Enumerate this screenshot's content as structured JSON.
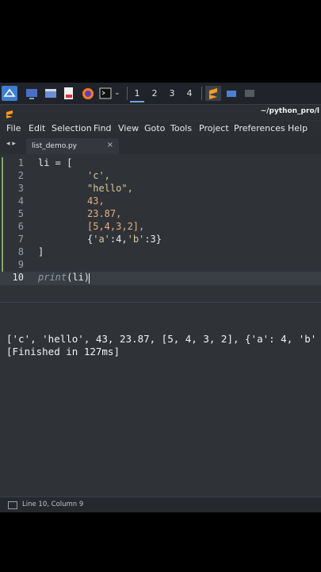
{
  "taskbar": {
    "workspaces": [
      "1",
      "2",
      "3",
      "4"
    ],
    "active_workspace": "1",
    "icons": [
      "start-menu-icon",
      "desktop-icon",
      "files-icon",
      "pdf-icon",
      "firefox-icon",
      "terminal-icon",
      "sublime-icon",
      "folder-icon",
      "window-icon"
    ],
    "accent": "#6da4e0"
  },
  "window": {
    "title_path": "~/python_pro/l"
  },
  "menu": {
    "items": [
      "File",
      "Edit",
      "Selection",
      "Find",
      "View",
      "Goto",
      "Tools",
      "Project",
      "Preferences",
      "Help"
    ]
  },
  "tabs": {
    "nav": "◂ ▸",
    "active_tab": "list_demo.py",
    "close": "×"
  },
  "editor": {
    "line_numbers": [
      "1",
      "2",
      "3",
      "4",
      "5",
      "6",
      "7",
      "8",
      "9",
      "10"
    ],
    "lines": [
      {
        "a": "li = ["
      },
      {
        "s": "'c',"
      },
      {
        "s": "\"hello\","
      },
      {
        "n": "43,"
      },
      {
        "n": "23.87,"
      },
      {
        "n": "[5,4,3,2],"
      },
      {
        "t": "{",
        "s": "'a'",
        "u": ":4,",
        "s2": "'b'",
        "u2": ":3}"
      },
      {
        "a": "]"
      },
      {
        "a": ""
      },
      {
        "f": "print",
        "p": "(li)"
      }
    ],
    "current_line": 10,
    "gutter_color": "#7fa86a"
  },
  "output": {
    "lines": [
      "['c', 'hello', 43, 23.87, [5, 4, 3, 2], {'a': 4, 'b'",
      "[Finished in 127ms]"
    ]
  },
  "status": {
    "position": "Line 10, Column 9"
  }
}
